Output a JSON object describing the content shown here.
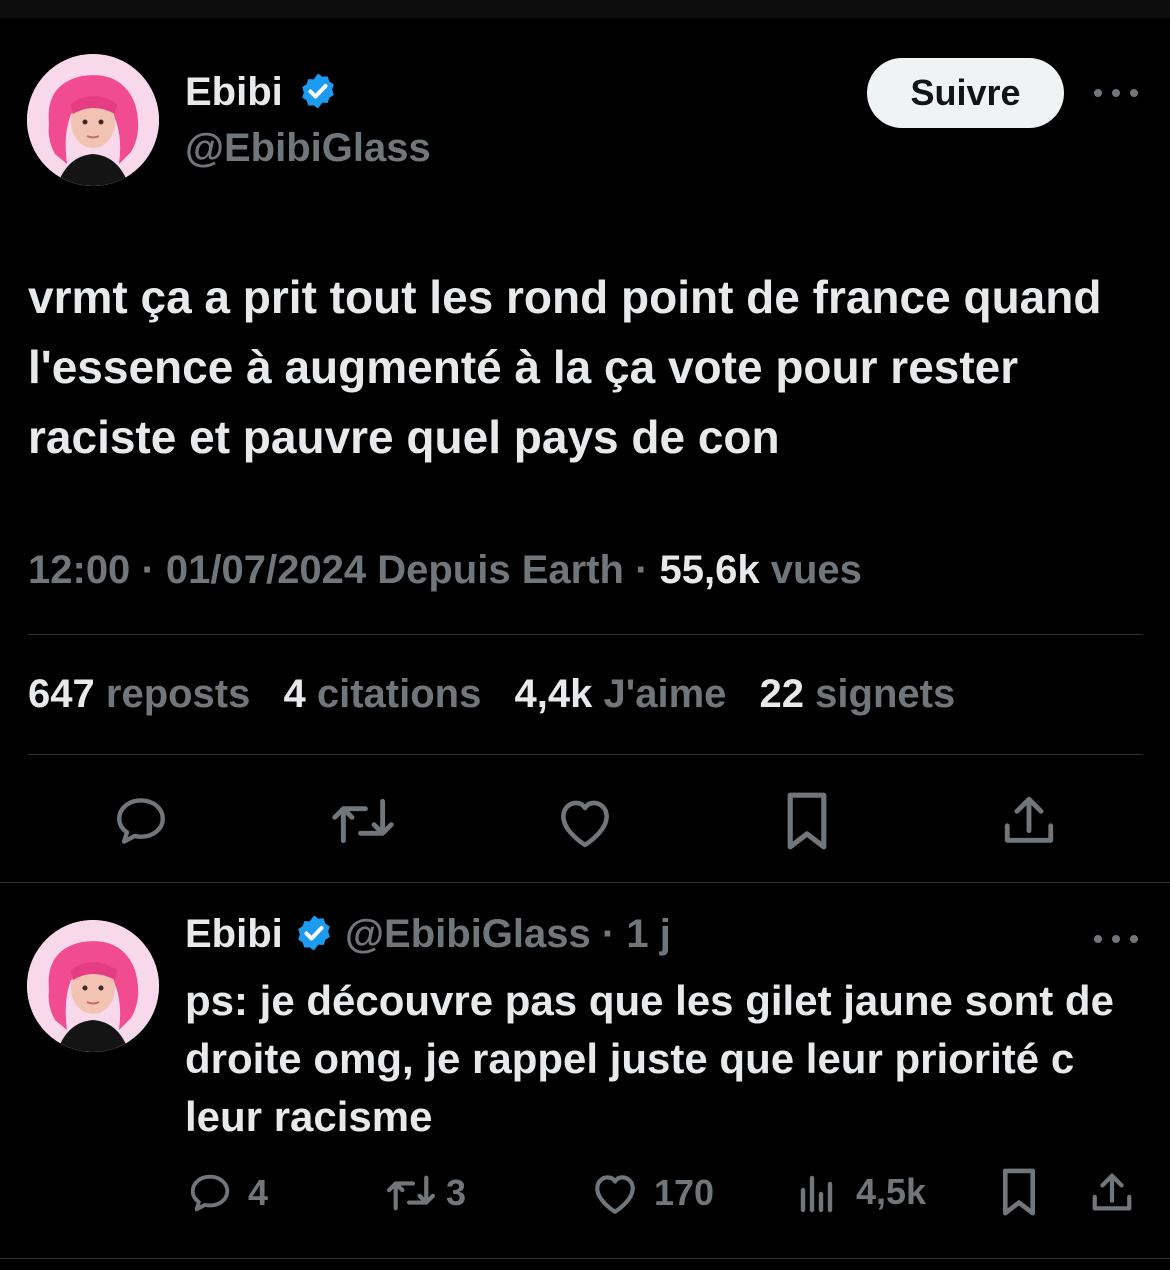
{
  "tweet": {
    "author": {
      "name": "Ebibi",
      "handle": "@EbibiGlass",
      "verified": true
    },
    "follow_label": "Suivre",
    "text": "vrmt ça a prit tout les rond point de france quand l'essence à augmenté à la ça vote pour rester raciste et pauvre quel pays de con",
    "meta": {
      "time": "12:00",
      "sep1": "·",
      "date": "01/07/2024",
      "source": "Depuis Earth",
      "sep2": "·",
      "views_count": "55,6k",
      "views_label": "vues"
    },
    "stats": {
      "reposts_count": "647",
      "reposts_label": "reposts",
      "quotes_count": "4",
      "quotes_label": "citations",
      "likes_count": "4,4k",
      "likes_label": "J'aime",
      "bookmarks_count": "22",
      "bookmarks_label": "signets"
    },
    "actions": [
      "reply-icon",
      "repost-icon",
      "like-icon",
      "bookmark-icon",
      "share-icon"
    ]
  },
  "reply": {
    "author": {
      "name": "Ebibi",
      "handle": "@EbibiGlass",
      "sep": "·",
      "age": "1 j",
      "verified": true
    },
    "text": "ps: je découvre pas que les gilet jaune sont de droite omg, je rappel juste que leur priorité c leur racisme",
    "counts": {
      "replies": "4",
      "reposts": "3",
      "likes": "170",
      "views": "4,5k"
    }
  },
  "colors": {
    "background": "#000000",
    "text": "#e7e9ea",
    "secondary": "#71767b",
    "divider": "#2f3336",
    "verified": "#1d9bf0",
    "avatar_hair": "#f0508f"
  }
}
